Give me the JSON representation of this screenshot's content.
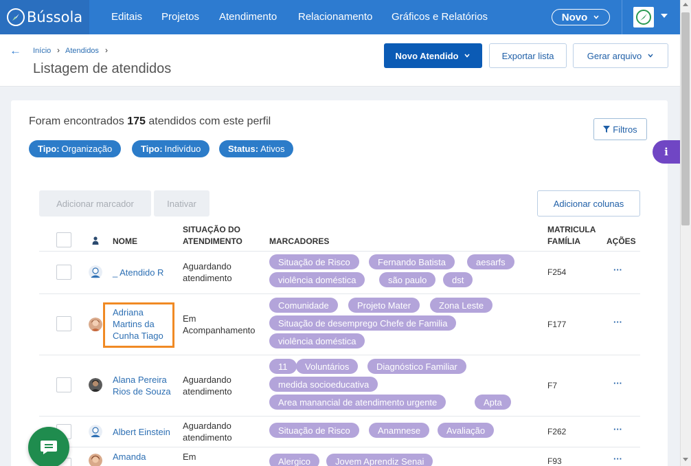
{
  "brand": {
    "name": "Bússola"
  },
  "nav": {
    "items": [
      "Editais",
      "Projetos",
      "Atendimento",
      "Relacionamento",
      "Gráficos e Relatórios"
    ],
    "novo_label": "Novo"
  },
  "breadcrumb": {
    "home": "Início",
    "current": "Atendidos",
    "sep": "›"
  },
  "page_title": "Listagem de atendidos",
  "actions": {
    "new_label": "Novo Atendido",
    "export_label": "Exportar lista",
    "generate_label": "Gerar arquivo"
  },
  "summary": {
    "prefix": "Foram encontrados",
    "count": "175",
    "suffix": "atendidos com este perfil"
  },
  "filters_label": "Filtros",
  "active_filters": [
    {
      "key": "Tipo:",
      "value": "Organização"
    },
    {
      "key": "Tipo:",
      "value": "Indivíduo"
    },
    {
      "key": "Status:",
      "value": "Ativos"
    }
  ],
  "info_label": "i",
  "bulk": {
    "add_marker_label": "Adicionar marcador",
    "inactivate_label": "Inativar",
    "add_columns_label": "Adicionar colunas"
  },
  "table": {
    "headers": {
      "name": "NOME",
      "situation_1": "SITUAÇÃO DO",
      "situation_2": "ATENDIMENTO",
      "markers": "MARCADORES",
      "family_1": "MATRICULA",
      "family_2": "FAMÍLIA",
      "actions": "AÇÕES"
    },
    "rows": [
      {
        "name": [
          "_ Atendido R"
        ],
        "situation": [
          "Aguardando",
          "atendimento"
        ],
        "markers": [
          [
            "Situação de Risco",
            "Fernando Batista",
            "aesarfs"
          ],
          [
            "violência doméstica",
            "são paulo",
            "dst"
          ]
        ],
        "family": "F254",
        "actions": "···"
      },
      {
        "name": [
          "Adriana",
          "Martins da",
          "Cunha Tiago"
        ],
        "situation": [
          "Em",
          "Acompanhamento"
        ],
        "markers": [
          [
            "Comunidade",
            "Projeto Mater",
            "Zona Leste"
          ],
          [
            "Situação de desemprego Chefe de Familia"
          ],
          [
            "violência doméstica"
          ]
        ],
        "family": "F177",
        "actions": "···"
      },
      {
        "name": [
          "Alana Pereira",
          "Rios de Souza"
        ],
        "situation": [
          "Aguardando",
          "atendimento"
        ],
        "markers": [
          [
            "11",
            "Voluntários",
            "Diagnóstico Familiar"
          ],
          [
            "medida socioeducativa"
          ],
          [
            "Area manancial de atendimento urgente",
            "Apta"
          ]
        ],
        "family": "F7",
        "actions": "···"
      },
      {
        "name": [
          "Albert Einstein"
        ],
        "situation": [
          "Aguardando",
          "atendimento"
        ],
        "markers": [
          [
            "Situação de Risco",
            "Anamnese",
            "Avaliação"
          ]
        ],
        "family": "F262",
        "actions": "···"
      },
      {
        "name": [
          "Amanda"
        ],
        "situation": [
          "Em"
        ],
        "markers": [
          [
            "Alergico",
            "Jovem Aprendiz Senai"
          ]
        ],
        "family": "F93",
        "actions": "···"
      }
    ]
  },
  "colors": {
    "nav": "#2d7bd0",
    "primary": "#0b5bb5",
    "pill": "#2c7cc9",
    "tag": "#b3a4da",
    "highlight": "#f08a24",
    "chat": "#1f8c4e"
  }
}
